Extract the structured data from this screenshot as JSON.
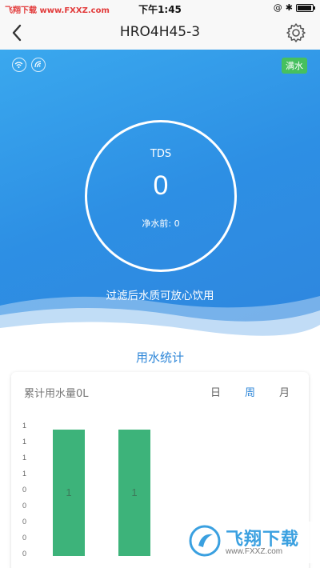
{
  "status_bar": {
    "source_label": "飞翔下载 www.FXXZ.com",
    "time": "下午1:45",
    "icons": [
      "at-icon",
      "bluetooth-icon",
      "battery-icon"
    ]
  },
  "nav": {
    "title": "HRO4H45-3",
    "back_icon": "chevron-left-icon",
    "settings_icon": "gear-icon"
  },
  "hero": {
    "icons": [
      "wifi-icon",
      "signal-icon"
    ],
    "badge": "满水",
    "tds_label": "TDS",
    "tds_value": "0",
    "tds_before": "净水前: 0",
    "message": "过滤后水质可放心饮用"
  },
  "stats": {
    "title": "用水统计",
    "total": "累计用水量0L",
    "tabs": [
      {
        "label": "日",
        "active": false
      },
      {
        "label": "周",
        "active": true
      },
      {
        "label": "月",
        "active": false
      }
    ],
    "chart_data": {
      "type": "bar",
      "y_ticks": [
        "1",
        "1",
        "1",
        "1",
        "0",
        "0",
        "0",
        "0",
        "0"
      ],
      "values": [
        1,
        1
      ],
      "value_labels": [
        "1",
        "1"
      ],
      "bar_color": "#3db37a"
    }
  },
  "watermark": {
    "name": "飞翔下载",
    "url": "www.FXXZ.com"
  },
  "colors": {
    "accent": "#2d86d8",
    "hero": "#2f8fe4",
    "bar": "#3db37a",
    "badge": "#46c05e"
  }
}
